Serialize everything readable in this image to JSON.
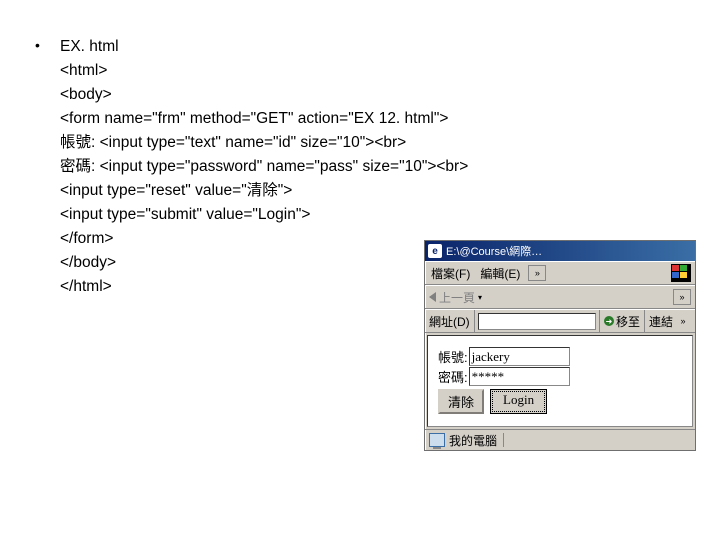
{
  "bullet": "•",
  "code": {
    "l0": "EX. html",
    "l1": "<html>",
    "l2": "<body>",
    "l3": "<form name=\"frm\" method=\"GET\" action=\"EX 12. html\">",
    "l4": "帳號: <input type=\"text\" name=\"id\" size=\"10\"><br>",
    "l5": "密碼: <input type=\"password\" name=\"pass\" size=\"10\"><br>",
    "l6": "<input type=\"reset\" value=\"清除\">",
    "l7": "<input type=\"submit\" value=\"Login\">",
    "l8": "</form>",
    "l9": "</body>",
    "l10": "</html>"
  },
  "browser": {
    "title": "E:\\@Course\\網際…",
    "menu_file": "檔案(F)",
    "menu_edit": "編輯(E)",
    "chev": "»",
    "back_label": "上一頁",
    "addr_label": "網址(D)",
    "go_label": "移至",
    "links_label": "連結",
    "form": {
      "id_label": "帳號:",
      "id_value": "jackery",
      "pass_label": "密碼:",
      "pass_value": "*****",
      "reset": "清除",
      "submit": "Login"
    },
    "status": "我的電腦"
  }
}
